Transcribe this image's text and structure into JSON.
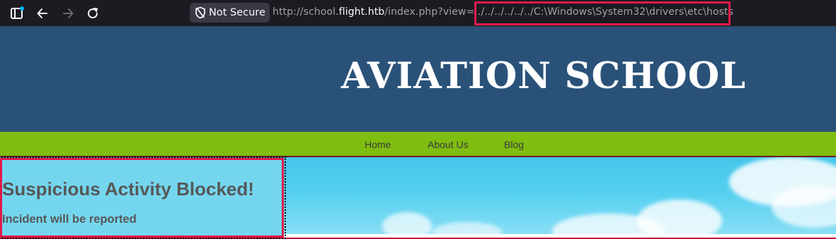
{
  "browser": {
    "security_label": "Not Secure",
    "url_prefix": "http://school.",
    "url_host": "flight.htb",
    "url_path": "/index.php?view=",
    "url_payload": "../../../../../../C:\\Windows\\System32\\drivers\\etc\\hosts",
    "colors": {
      "highlight": "#e3194a",
      "toolbar": "#1c1b22"
    }
  },
  "site": {
    "title": "AVIATION SCHOOL",
    "nav": [
      "Home",
      "About Us",
      "Blog"
    ],
    "colors": {
      "header": "#2a5279",
      "nav": "#7fbd10",
      "sky": "#56d0f0"
    }
  },
  "alert": {
    "title": "Suspicious Activity Blocked!",
    "message": "Incident will be reported"
  }
}
